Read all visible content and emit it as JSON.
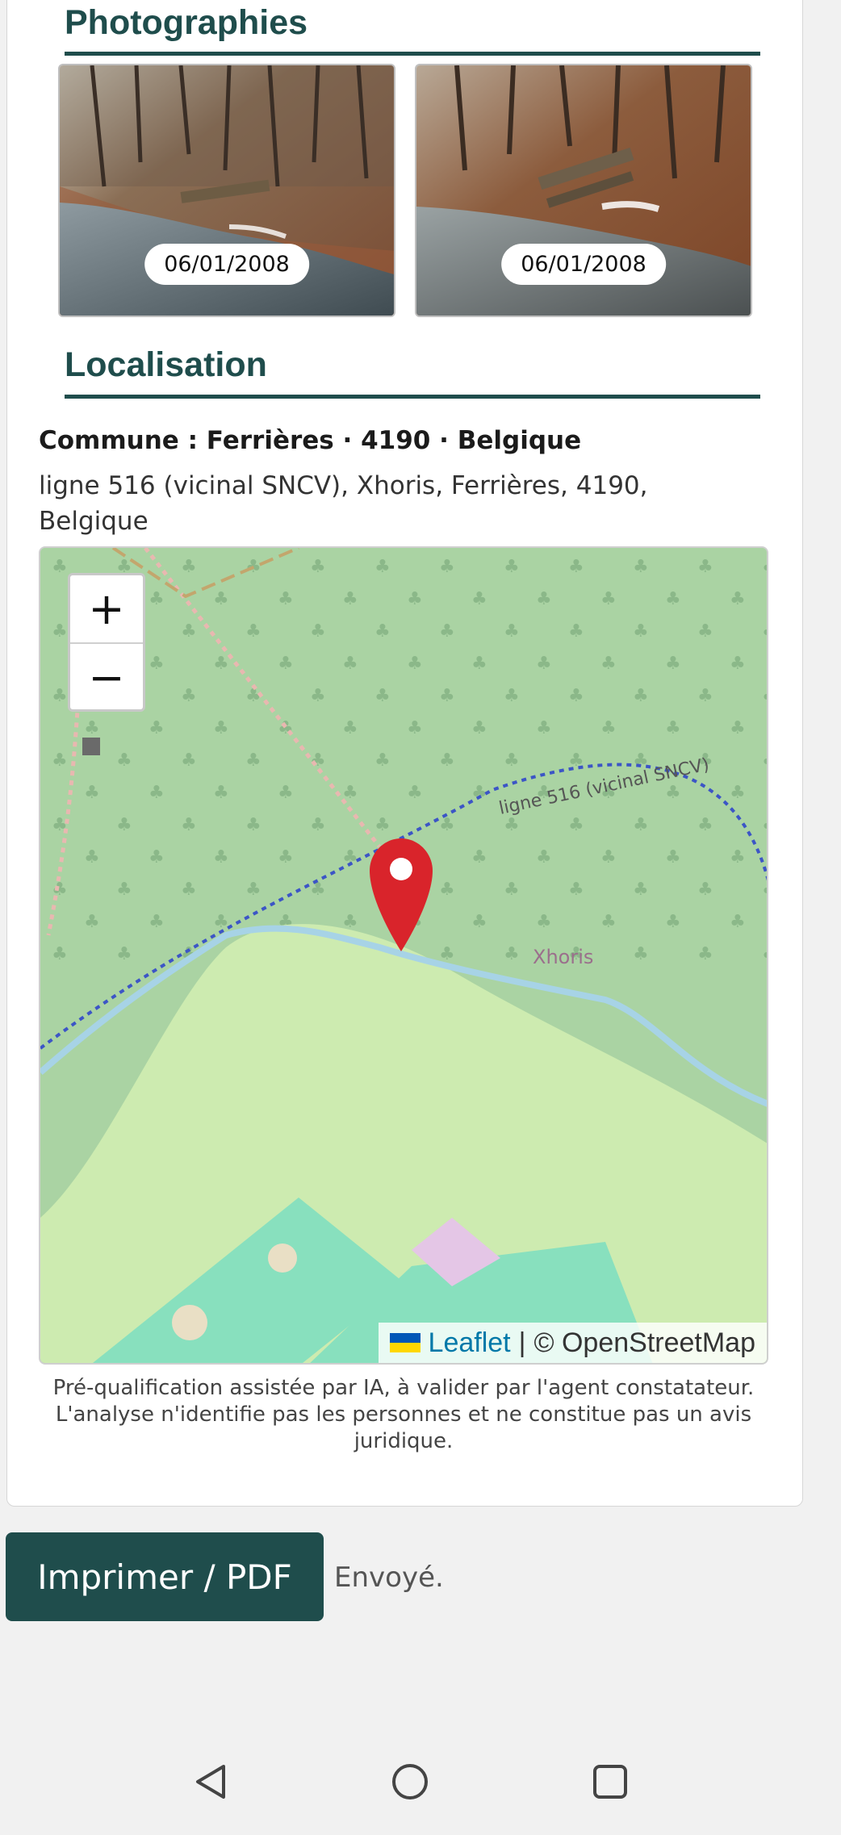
{
  "photos": {
    "title": "Photographies",
    "items": [
      {
        "date": "06/01/2008"
      },
      {
        "date": "06/01/2008"
      }
    ]
  },
  "location": {
    "title": "Localisation",
    "commune_line": "Commune : Ferrières · 4190 · Belgique",
    "address": "ligne 516 (vicinal SNCV), Xhoris, Ferrières, 4190, Belgique"
  },
  "map": {
    "zoom_in": "+",
    "zoom_out": "−",
    "labels": {
      "railway": "ligne 516 (vicinal SNCV)",
      "place": "Xhoris"
    },
    "attribution": {
      "leaflet": "Leaflet",
      "separator": "|",
      "osm": "© OpenStreetMap"
    },
    "colors": {
      "forest": "#aad3a3",
      "meadow": "#cdebb0",
      "pitch": "#88e0be",
      "water": "#a7d3e6",
      "marker": "#d9242b"
    }
  },
  "disclaimer": "Pré-qualification assistée par IA, à valider par l'agent constatateur. L'analyse n'identifie pas les personnes et ne constitue pas un avis juridique.",
  "actions": {
    "print_label": "Imprimer / PDF",
    "status": "Envoyé."
  },
  "system_nav": {
    "back": "back-icon",
    "home": "home-icon",
    "recents": "recents-icon"
  }
}
